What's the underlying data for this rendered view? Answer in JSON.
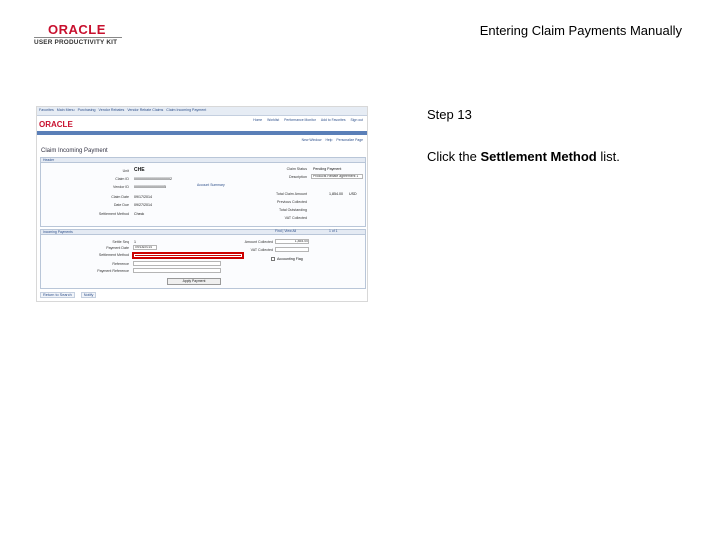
{
  "header": {
    "logo_word": "ORACLE",
    "logo_sub": "USER PRODUCTIVITY KIT",
    "doc_title": "Entering Claim Payments Manually"
  },
  "step": {
    "label": "Step 13",
    "instruction_prefix": "Click the ",
    "instruction_target": "Settlement Method",
    "instruction_suffix": " list."
  },
  "thumbnail": {
    "breadcrumbs": [
      "Favorites",
      "Main Menu",
      "Purchasing",
      "Vendor Rebates",
      "Vendor Rebate Claims",
      "Claim Incoming Payment"
    ],
    "logo": "ORACLE",
    "top_links": [
      "Home",
      "Worklist",
      "Performance Monitor",
      "Add to Favorites",
      "Sign out"
    ],
    "nav_links": [
      "New Window",
      "Help",
      "Personalize Page"
    ],
    "page_title": "Claim Incoming Payment",
    "header_section": {
      "title": "Header",
      "unit_label": "Unit",
      "unit_value": "CHE",
      "claim_id_label": "Claim ID",
      "claim_id_value": "0000000000000000002",
      "claim_status_label": "Claim Status",
      "claim_status_value": "Pending Payment",
      "description_label": "Description",
      "description_value": "Products Rebate agreement 1",
      "vendor_label": "Vendor ID",
      "vendor_value": "0000000000000005",
      "claim_date_label": "Claim Date",
      "claim_date_value": "09/17/2014",
      "date_due_label": "Date Due",
      "date_due_value": "09/27/2014",
      "settlement_label": "Settlement Method",
      "settlement_value": "Check",
      "account_summary_link": "Account Summary",
      "total_claim_label": "Total Claim Amount",
      "total_claim_value": "1,854.00",
      "currency": "USD",
      "prev_collected_label": "Previous Collected",
      "total_outstanding_label": "Total Outstanding",
      "vat_label": "VAT Collected"
    },
    "payment_section": {
      "title": "Incoming Payments",
      "nav_text": "Find | View All",
      "pager": "1 of 1",
      "settle_seq_label": "Settle Seq",
      "settle_seq_value": "1",
      "payment_date_label": "Payment Date",
      "payment_date_value": "09/18/2014",
      "settlement_method_label": "Settlement Method",
      "reference_label": "Reference",
      "payment_ref_label": "Payment Reference",
      "amount_collected_label": "Amount Collected",
      "amount_collected_value": "1,854.00",
      "vat_collected_label": "VAT Collected",
      "accounting_flag_label": "Accounting Flag",
      "apply_button": "Apply Payment"
    },
    "bottom_links": [
      "Return to Search",
      "Notify"
    ]
  }
}
